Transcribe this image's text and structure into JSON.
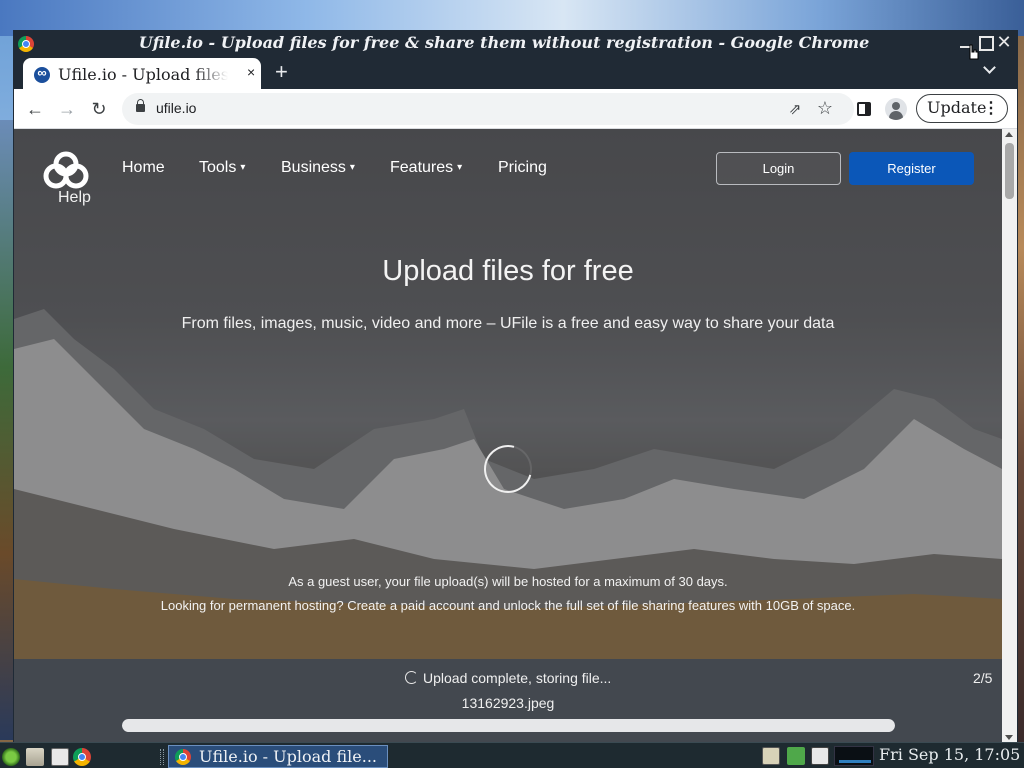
{
  "window": {
    "title": "Ufile.io - Upload files for free & share them without registration - Google Chrome"
  },
  "browser": {
    "tab_label": "Ufile.io - Upload files for free & share them without registration",
    "tab_close": "×",
    "new_tab": "+",
    "url": "ufile.io",
    "update_label": "Update",
    "menu_glyph": "⋮",
    "back_glyph": "←",
    "forward_glyph": "→",
    "reload_glyph": "↻",
    "star_glyph": "☆",
    "share_glyph": "⇗",
    "close_glyph": "✕"
  },
  "site": {
    "nav": {
      "home": "Home",
      "tools": "Tools",
      "business": "Business",
      "features": "Features",
      "pricing": "Pricing",
      "help": "Help",
      "caret": "▾"
    },
    "login": "Login",
    "register": "Register",
    "hero_title": "Upload files for free",
    "hero_subtitle": "From files, images, music, video and more – UFile is a free and easy way to share your data",
    "guest_note": "As a guest user, your file upload(s) will be hosted for a maximum of 30 days.",
    "paid_note": "Looking for permanent hosting? Create a paid account and unlock the full set of file sharing features with 10GB of space.",
    "upload": {
      "status": "Upload complete, storing file...",
      "count": "2/5",
      "filename": "13162923.jpeg",
      "progress": 1.0
    }
  },
  "taskbar": {
    "task_label": "Ufile.io - Upload file...",
    "clock": "Fri Sep 15, 17:05"
  },
  "colors": {
    "register_blue": "#0b57b8",
    "titlebar": "#202a35",
    "upload_panel": "#43484f"
  }
}
